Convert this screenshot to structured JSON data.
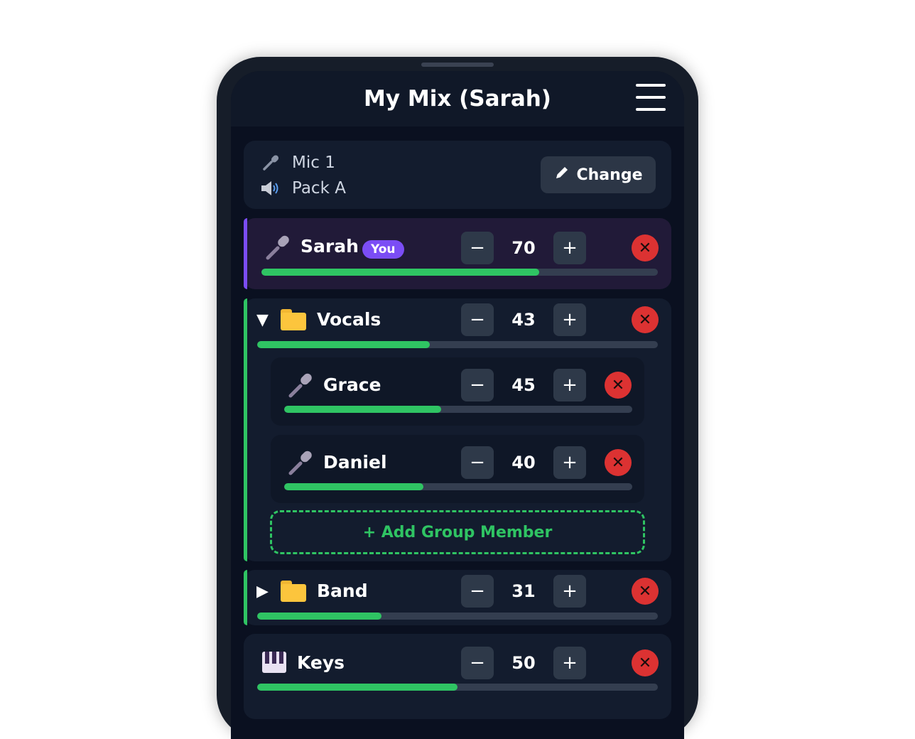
{
  "app": {
    "title": "My Mix (Sarah)"
  },
  "source": {
    "mic_label": "Mic 1",
    "pack_label": "Pack A",
    "change_label": "Change"
  },
  "channels": {
    "self": {
      "name": "Sarah",
      "badge": "You",
      "level": 70,
      "level_display": "70",
      "accent": "#7b4df5"
    },
    "vocals": {
      "name": "Vocals",
      "level": 43,
      "level_display": "43",
      "expanded": true,
      "accent": "#2fc463",
      "members": [
        {
          "name": "Grace",
          "level": 45,
          "level_display": "45"
        },
        {
          "name": "Daniel",
          "level": 40,
          "level_display": "40"
        }
      ],
      "add_label": "+ Add Group Member"
    },
    "band": {
      "name": "Band",
      "level": 31,
      "level_display": "31",
      "expanded": false,
      "accent": "#2fc463"
    },
    "keys": {
      "name": "Keys",
      "level": 50,
      "level_display": "50"
    }
  },
  "controls": {
    "minus": "−",
    "plus": "+",
    "remove": "✕",
    "caret_open": "▼",
    "caret_closed": "▶"
  },
  "icons": {
    "menu": "hamburger-menu-icon",
    "mic": "microphone-icon",
    "speaker": "speaker-icon",
    "pencil": "pencil-icon",
    "folder": "folder-icon",
    "piano": "piano-keys-icon"
  },
  "colors": {
    "level_fill": "#2fc463",
    "remove": "#dc3232",
    "badge": "#7b4df5"
  }
}
